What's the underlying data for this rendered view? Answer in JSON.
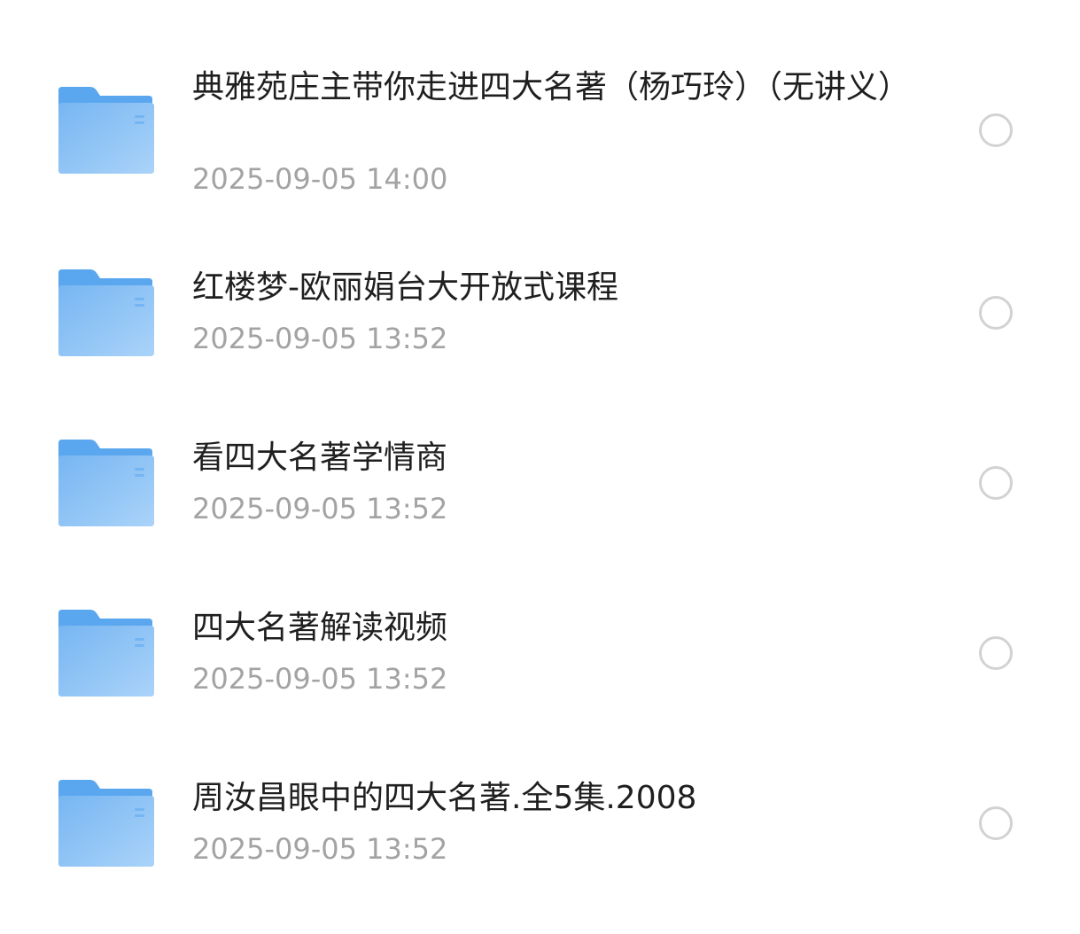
{
  "files": [
    {
      "name": "典雅苑庄主带你走进四大名著（杨巧玲）（无讲义）",
      "date": "2025-09-05 14:00",
      "icon": "folder-icon",
      "selected": false
    },
    {
      "name": "红楼梦-欧丽娟台大开放式课程",
      "date": "2025-09-05 13:52",
      "icon": "folder-icon",
      "selected": false
    },
    {
      "name": "看四大名著学情商",
      "date": "2025-09-05 13:52",
      "icon": "folder-icon",
      "selected": false
    },
    {
      "name": "四大名著解读视频",
      "date": "2025-09-05 13:52",
      "icon": "folder-icon",
      "selected": false
    },
    {
      "name": "周汝昌眼中的四大名著.全5集.2008",
      "date": "2025-09-05 13:52",
      "icon": "folder-icon",
      "selected": false
    }
  ],
  "colors": {
    "folder_back": "#5aa7f0",
    "folder_front_top": "#79b8f3",
    "folder_front_bottom": "#a6d0f8",
    "name_text": "#1f1f1f",
    "date_text": "#a3a3a3",
    "radio_border": "#d2d2d2"
  }
}
